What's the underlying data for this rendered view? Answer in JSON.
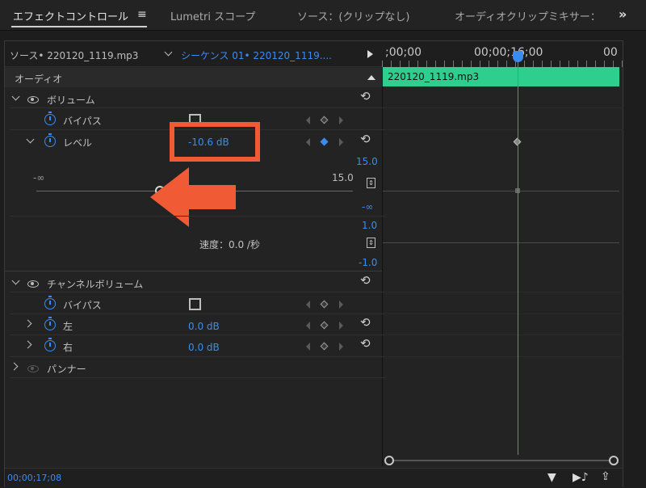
{
  "tabs": [
    {
      "label": "エフェクトコントロール"
    },
    {
      "label": "Lumetri スコープ"
    },
    {
      "label": "ソース：(クリップなし)"
    },
    {
      "label": "オーディオクリップミキサー："
    }
  ],
  "tab_menu_icon": "hamburger-icon",
  "overflow_icon": "double-chevron-right-icon",
  "source": {
    "label": "ソース• 220120_1119.mp3",
    "sequence": "シーケンス 01• 220120_1119...."
  },
  "timeline": {
    "timecodes": [
      ";00;00",
      "00;00;16;00",
      "00"
    ],
    "clip_name": "220120_1119.mp3",
    "clip_color": "#2ecf8e",
    "playhead_color": "#3b8cf0"
  },
  "section_audio": "オーディオ",
  "volume": {
    "label": "ボリューム",
    "bypass_label": "バイパス",
    "level_label": "レベル",
    "level_value": "-10.6 dB",
    "slider_min": "-∞",
    "slider_max": "15.0",
    "slider_fraction": 0.39,
    "speed_label": "速度：0.0 /秒",
    "graph_top": "15.0",
    "graph_bottom": "-∞",
    "velocity_top": "1.0",
    "velocity_bottom": "-1.0"
  },
  "channel_volume": {
    "label": "チャンネルボリューム",
    "bypass_label": "バイパス",
    "left_label": "左",
    "left_value": "0.0 dB",
    "right_label": "右",
    "right_value": "0.0 dB"
  },
  "panner": {
    "label": "パンナー"
  },
  "footer": {
    "timecode": "00;00;17;08"
  },
  "highlight_color": "#f05a35"
}
